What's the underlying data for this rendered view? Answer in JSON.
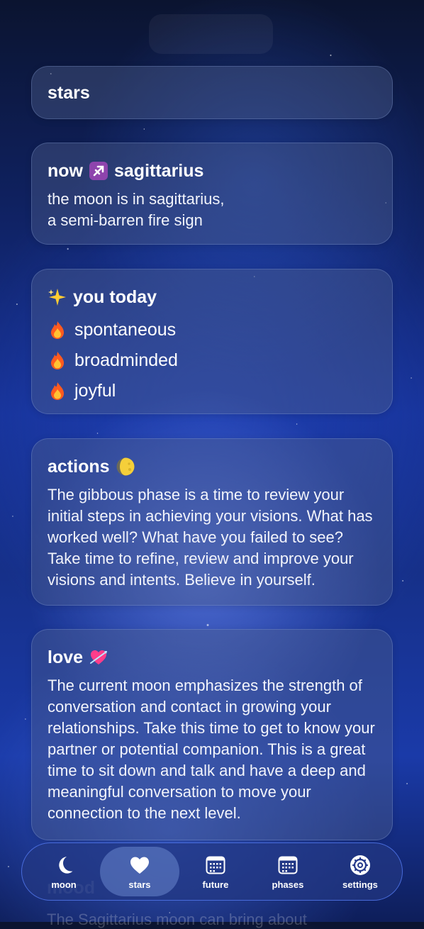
{
  "cards": {
    "stars": {
      "title": "stars"
    },
    "now": {
      "title_prefix": "now",
      "sign": "sagittarius",
      "line1": "the moon is in sagittarius,",
      "line2": "a semi-barren fire sign"
    },
    "today": {
      "title": "you today",
      "traits": [
        "spontaneous",
        "broadminded",
        "joyful"
      ]
    },
    "actions": {
      "title": "actions",
      "text": "The gibbous phase is a time to review your initial steps in achieving your visions. What has worked well? What have you failed to see? Take time to refine, review and improve your visions and intents. Believe in yourself."
    },
    "love": {
      "title": "love",
      "text": "The current moon emphasizes the strength of conversation and contact in growing your relationships. Take this time to get to know your partner or potential companion. This is a great time to sit down and talk and have a deep and meaningful conversation to move your connection to the next level."
    },
    "behind": {
      "title": "mood",
      "text": "The Sagittarius moon can bring about"
    }
  },
  "tabs": [
    {
      "label": "moon",
      "icon": "moon-icon"
    },
    {
      "label": "stars",
      "icon": "heart-icon",
      "active": true
    },
    {
      "label": "future",
      "icon": "calendar-icon"
    },
    {
      "label": "phases",
      "icon": "calendar-icon"
    },
    {
      "label": "settings",
      "icon": "gear-icon"
    }
  ],
  "colors": {
    "accent": "#4a6cff",
    "sagittarius_tile": "#8e44ad",
    "fire": "#ff5a1f"
  }
}
